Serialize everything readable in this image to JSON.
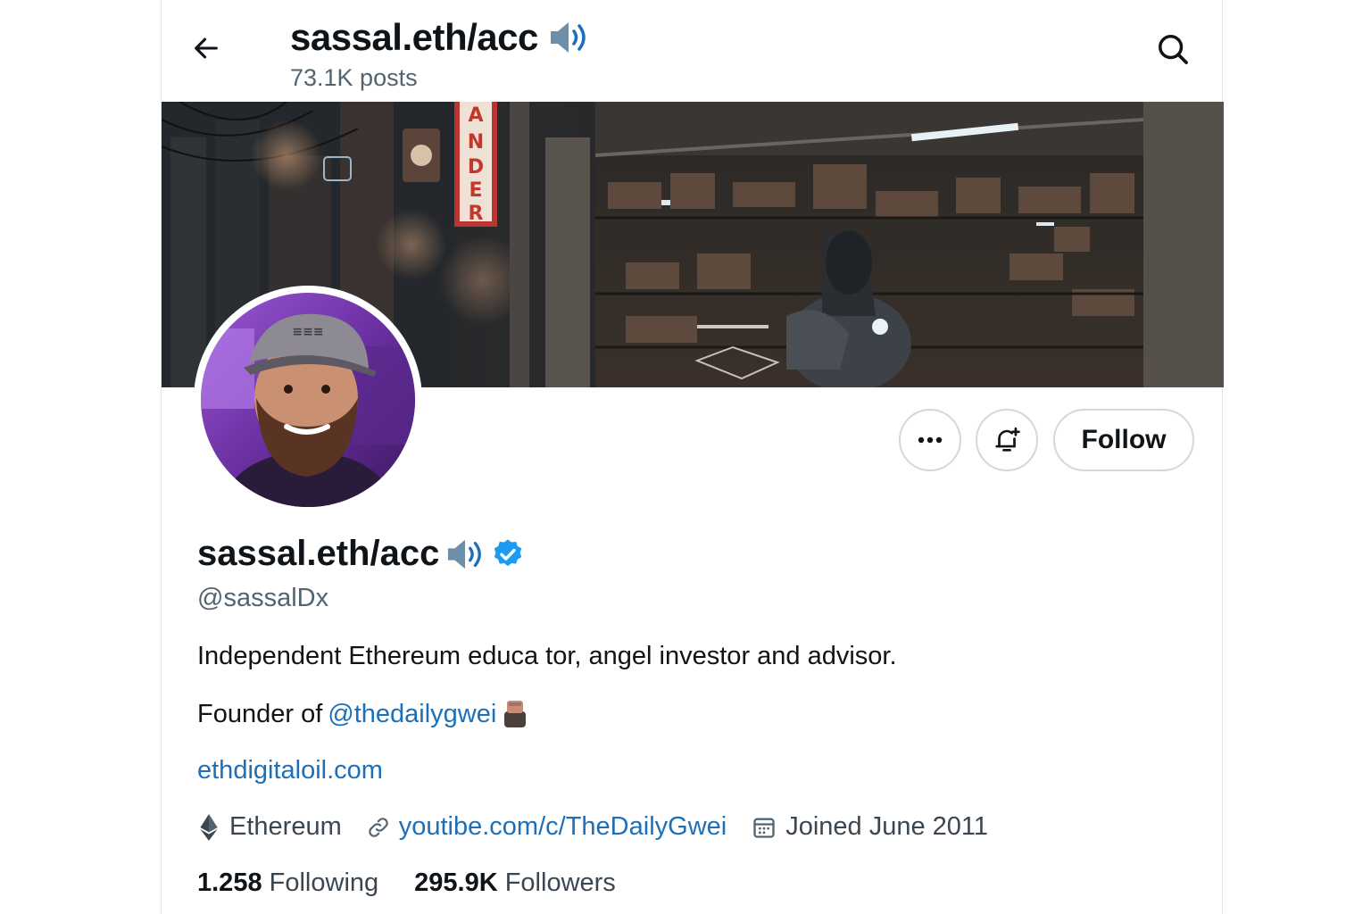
{
  "header": {
    "title": "sassal.eth/acc",
    "posts": "73.1K posts"
  },
  "profile": {
    "display_name": "sassal.eth/acc",
    "handle": "@sassalDx",
    "bio": "Independent Ethereum educa tor, angel investor and advisor.",
    "founder_prefix": "Founder of",
    "founder_link": "@thedailygwei",
    "website": "ethdigitaloil.com",
    "location": "Ethereum",
    "youtube": "youtibe.com/c/TheDailyGwei",
    "joined": "Joined June 2011"
  },
  "banner": {
    "sign_text": "ANDER"
  },
  "actions": {
    "follow_label": "Follow"
  },
  "stats": {
    "following_count": "1.258",
    "following_label": "Following",
    "followers_count": "295.9K",
    "followers_label": "Followers"
  },
  "icons": {
    "back": "back-arrow-icon",
    "search": "search-icon",
    "speaker": "speaker-icon",
    "verified": "verified-badge-icon",
    "more": "more-icon",
    "notify": "bell-plus-icon",
    "location": "ethereum-icon",
    "link": "link-icon",
    "calendar": "calendar-icon"
  },
  "colors": {
    "link": "#1d6fb8",
    "verified": "#1d9bf0",
    "muted": "#536471",
    "speaker": "#6f8fa8"
  }
}
